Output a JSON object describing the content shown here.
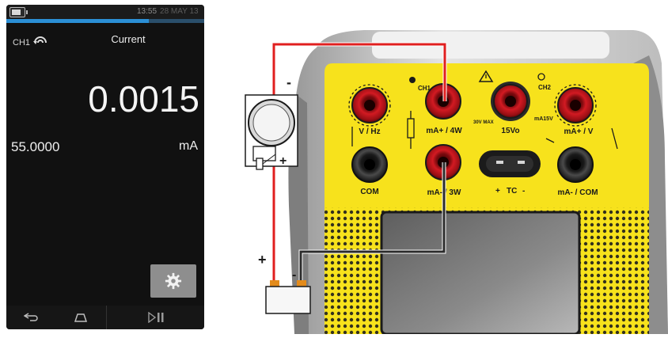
{
  "screen": {
    "status": {
      "time": "13:55",
      "date": "28 MAY 13",
      "battery_level": 0.75,
      "progress_level": 0.72
    },
    "channel_label": "CH1",
    "mode_title": "Current",
    "main_reading": "0.0015",
    "setpoint_value": "55.0000",
    "unit": "mA",
    "icons": {
      "channel": "loop-source-icon",
      "settings": "gear-icon",
      "back": "back-arrow-icon",
      "home": "home-icon",
      "play_pause": "play-pause-icon"
    }
  },
  "diagram": {
    "terminals": {
      "ch1": "CH1",
      "ch2": "CH2",
      "v_hz": "V / Hz",
      "ma_4w": "mA+ / 4W",
      "max": "30V MAX",
      "v15": "15Vo",
      "ma15v": "mA15V",
      "ma_v": "mA+ / V",
      "com": "COM",
      "ma_3w": "mA- / 3W",
      "tc": "TC",
      "tc_plus": "+",
      "tc_minus": "-",
      "ma_com": "mA- / COM"
    },
    "polarity": {
      "gauge_minus": "-",
      "gauge_plus": "+",
      "supply_plus": "+",
      "supply_minus": "-"
    },
    "colors": {
      "yellow_panel": "#f7e21c",
      "red_terminal": "#c3161c",
      "black_terminal": "#222222",
      "red_wire": "#e01f1f",
      "black_wire": "#2b2b2b",
      "housing_grey": "#cfcfcf"
    }
  }
}
